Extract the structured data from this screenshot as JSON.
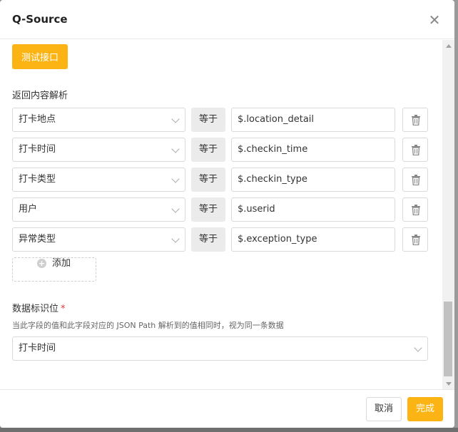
{
  "dialog": {
    "title": "Q-Source",
    "close_icon": "close-icon"
  },
  "toolbar": {
    "test_label": "测试接口"
  },
  "response_parsing": {
    "label": "返回内容解析",
    "rows": [
      {
        "field": "打卡地点",
        "operator": "等于",
        "path": "$.location_detail"
      },
      {
        "field": "打卡时间",
        "operator": "等于",
        "path": "$.checkin_time"
      },
      {
        "field": "打卡类型",
        "operator": "等于",
        "path": "$.checkin_type"
      },
      {
        "field": "用户",
        "operator": "等于",
        "path": "$.userid"
      },
      {
        "field": "异常类型",
        "operator": "等于",
        "path": "$.exception_type"
      }
    ],
    "add_label": "添加",
    "add_icon": "plus-circle-icon",
    "delete_icon": "trash-icon"
  },
  "identifier": {
    "label": "数据标识位",
    "required_mark": "*",
    "hint": "当此字段的值和此字段对应的 JSON Path 解析到的值相同时，视为同一条数据",
    "selected": "打卡时间"
  },
  "footer": {
    "cancel_label": "取消",
    "done_label": "完成"
  },
  "colors": {
    "accent": "#fbb414",
    "required": "#e53935",
    "backdrop": "#8c8c8c"
  }
}
